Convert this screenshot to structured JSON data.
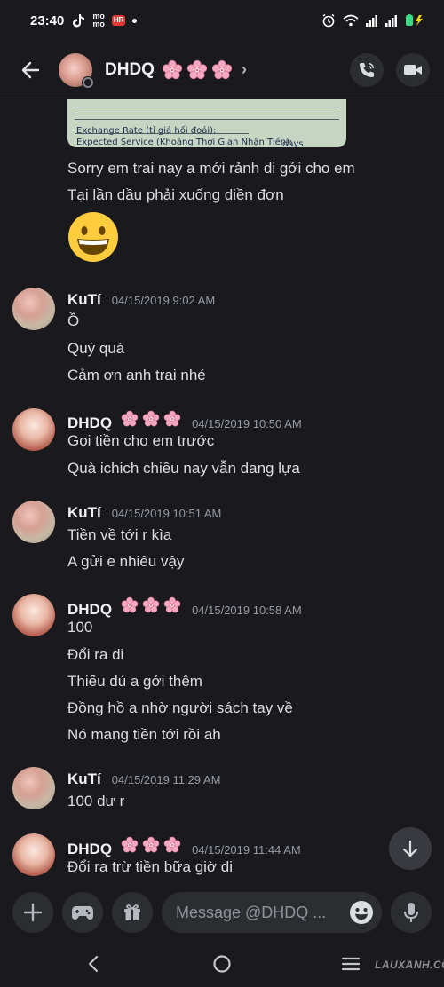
{
  "status_bar": {
    "time": "23:40",
    "icons_left": [
      "tiktok-icon",
      "momo-icon",
      "app-badge-icon",
      "dot-icon"
    ],
    "app_badge": "HR",
    "icons_right": [
      "alarm-icon",
      "wifi-icon",
      "signal-icon",
      "signal-icon",
      "battery-charging-icon"
    ]
  },
  "header": {
    "contact_name": "DHDQ 🌸🌸🌸",
    "name_text": "DHDQ",
    "actions": [
      "phone-call-icon",
      "video-call-icon"
    ]
  },
  "attachment": {
    "line1": "Exchange Rate (tỉ giá hối đoái):",
    "line2": "Expected Service (Khoảng Thời Gian Nhận Tiền):",
    "line2_suffix": "days"
  },
  "messages": {
    "first_block": [
      "Sorry em trai nay a mới rảnh di gởi cho em",
      "Tại lần dầu phải xuống diền đơn"
    ],
    "emoji": "grinning-face",
    "groups": [
      {
        "author": "KuTí",
        "timestamp": "04/15/2019 9:02 AM",
        "lines": [
          "Ồ",
          "Quý quá",
          "Cảm ơn anh trai nhé"
        ]
      },
      {
        "author": "DHDQ",
        "timestamp": "04/15/2019 10:50 AM",
        "lines": [
          "Goi tiền cho em trước",
          "Quà ichich chiều nay vẫn dang lựa"
        ]
      },
      {
        "author": "KuTí",
        "timestamp": "04/15/2019 10:51 AM",
        "lines": [
          "Tiền về tới r kìa",
          "A gửi e nhiêu vậy"
        ]
      },
      {
        "author": "DHDQ",
        "timestamp": "04/15/2019 10:58 AM",
        "lines": [
          "100",
          "Đổi ra di",
          "Thiếu dủ a gởi thêm",
          "Đồng hồ a nhờ người sách tay về",
          "Nó mang tiền tới rồi ah"
        ]
      },
      {
        "author": "KuTí",
        "timestamp": "04/15/2019 11:29 AM",
        "lines": [
          "100 dư r"
        ]
      },
      {
        "author": "DHDQ",
        "timestamp": "04/15/2019 11:44 AM",
        "lines": [
          "Đổi ra trừ tiền bữa giờ di"
        ]
      }
    ]
  },
  "input_bar": {
    "placeholder": "Message @DHDQ ...",
    "buttons": [
      "plus-icon",
      "gamepad-icon",
      "gift-icon",
      "emoji-icon",
      "microphone-icon"
    ]
  },
  "nav_bar": {
    "watermark": "LAUXANH.CC"
  },
  "colors": {
    "background": "#1a1a1e",
    "button_bg": "#2b2d31",
    "text": "#dbdee1",
    "timestamp": "#949ba4"
  }
}
